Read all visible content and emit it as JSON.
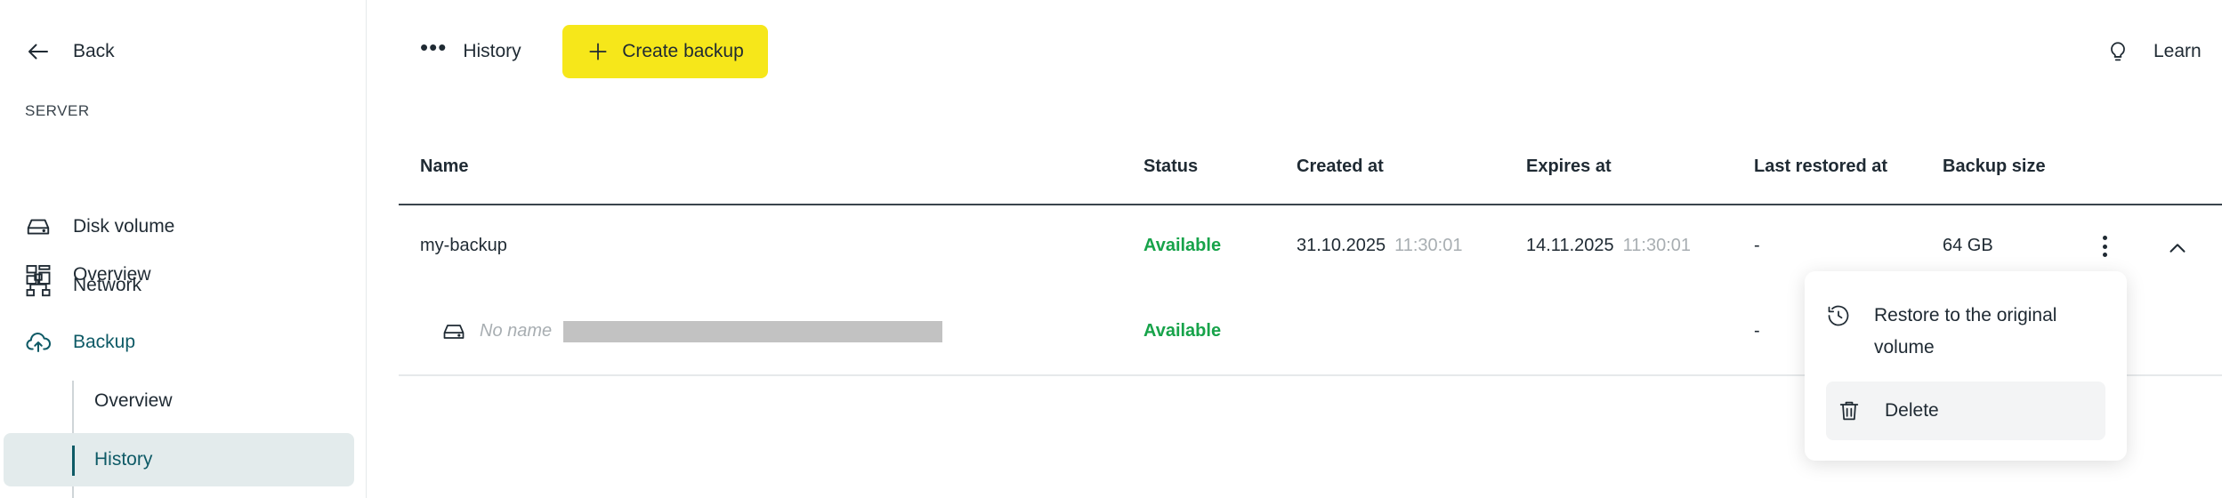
{
  "sidebar": {
    "back_label": "Back",
    "section_label": "SERVER",
    "items": [
      {
        "label": "Overview",
        "icon": "dashboard-icon"
      },
      {
        "label": "Disk volume",
        "icon": "disk-icon"
      },
      {
        "label": "Network",
        "icon": "network-icon"
      },
      {
        "label": "Backup",
        "icon": "cloud-upload-icon"
      }
    ],
    "sub_items": [
      {
        "label": "Overview"
      },
      {
        "label": "History"
      }
    ]
  },
  "toolbar": {
    "history_label": "History",
    "create_label": "Create backup",
    "learn_label": "Learn"
  },
  "table": {
    "columns": [
      "Name",
      "Status",
      "Created at",
      "Expires at",
      "Last restored at",
      "Backup size"
    ],
    "rows": [
      {
        "name": "my-backup",
        "status": "Available",
        "created_date": "31.10.2025",
        "created_time": "11:30:01",
        "expires_date": "14.11.2025",
        "expires_time": "11:30:01",
        "last_restored": "-",
        "size": "64 GB",
        "children": [
          {
            "name": "No name",
            "status": "Available",
            "last_restored": "-"
          }
        ]
      }
    ]
  },
  "menu": {
    "restore_line1": "Restore to the original",
    "restore_line2": "volume",
    "delete_label": "Delete"
  },
  "colors": {
    "accent": "#f6e71a",
    "active_nav": "#0e5a66",
    "status_available": "#17a34a",
    "active_bg": "#e3ebec"
  }
}
